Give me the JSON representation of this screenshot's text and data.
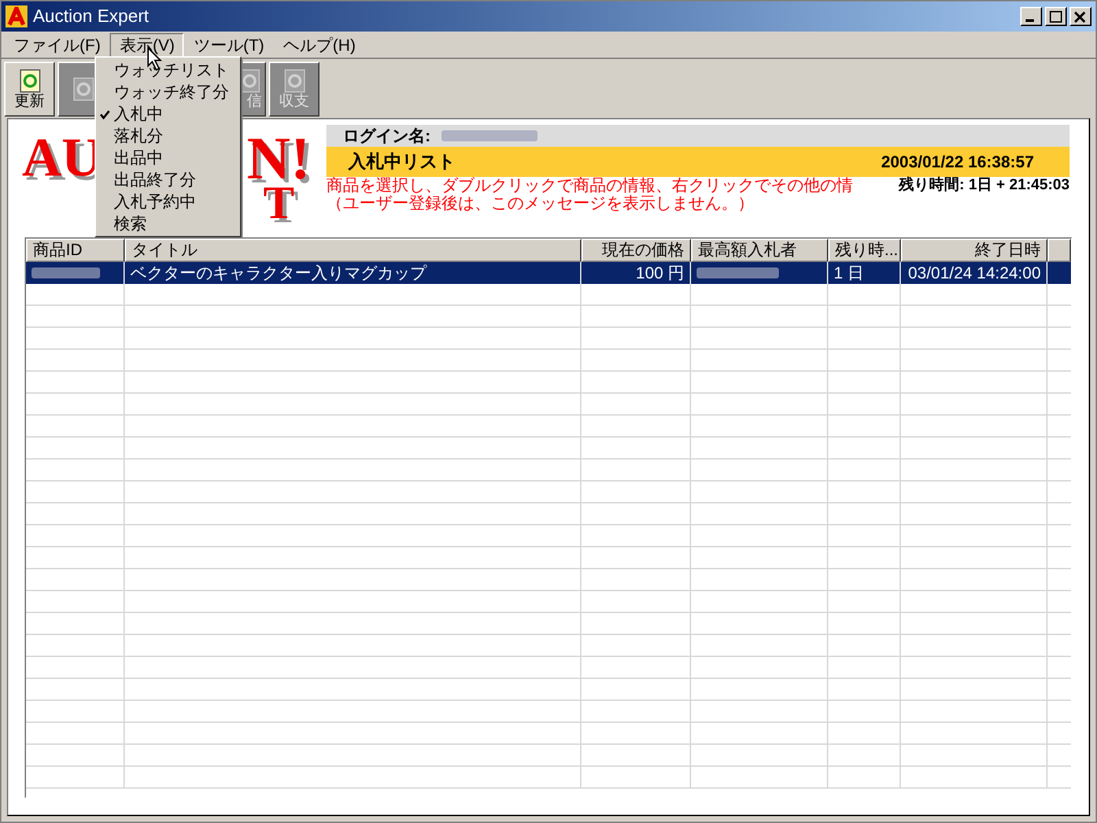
{
  "window": {
    "title": "Auction Expert"
  },
  "menu_bar": [
    {
      "label": "ファイル(F)",
      "selected": false
    },
    {
      "label": "表示(V)",
      "selected": true
    },
    {
      "label": "ツール(T)",
      "selected": false
    },
    {
      "label": "ヘルプ(H)",
      "selected": false
    }
  ],
  "toolbar": [
    {
      "label": "更新",
      "disabled": false
    },
    {
      "disabled": true
    },
    {
      "label": "信",
      "disabled": true
    },
    {
      "label": "収支",
      "disabled": true
    }
  ],
  "dropdown": [
    {
      "label": "ウォッチリスト",
      "checked": false
    },
    {
      "label": "ウォッチ終了分",
      "checked": false
    },
    {
      "label": "入札中",
      "checked": true
    },
    {
      "label": "落札分",
      "checked": false
    },
    {
      "label": "出品中",
      "checked": false
    },
    {
      "label": "出品終了分",
      "checked": false
    },
    {
      "label": "入札予約中",
      "checked": false
    },
    {
      "label": "検索",
      "checked": false
    }
  ],
  "logo": {
    "parts": [
      "AU",
      "N!",
      "T"
    ]
  },
  "info": {
    "login_label": "ログイン名:",
    "list_title": "入札中リスト",
    "datetime": "2003/01/22 16:38:57",
    "message": [
      "商品を選択し、ダブルクリックで商品の情報、右クリックでその他の情",
      "（ユーザー登録後は、このメッセージを表示しません。）"
    ],
    "remaining": "残り時間: 1日 + 21:45:03"
  },
  "table": {
    "columns": [
      "商品ID",
      "タイトル",
      "現在の価格",
      "最高額入札者",
      "残り時...",
      "終了日時"
    ],
    "rows": [
      {
        "selected": true,
        "cells": [
          "",
          "ベクターのキャラクター入りマグカップ",
          "100 円",
          "",
          "1 日",
          "03/01/24 14:24:00"
        ]
      }
    ]
  }
}
